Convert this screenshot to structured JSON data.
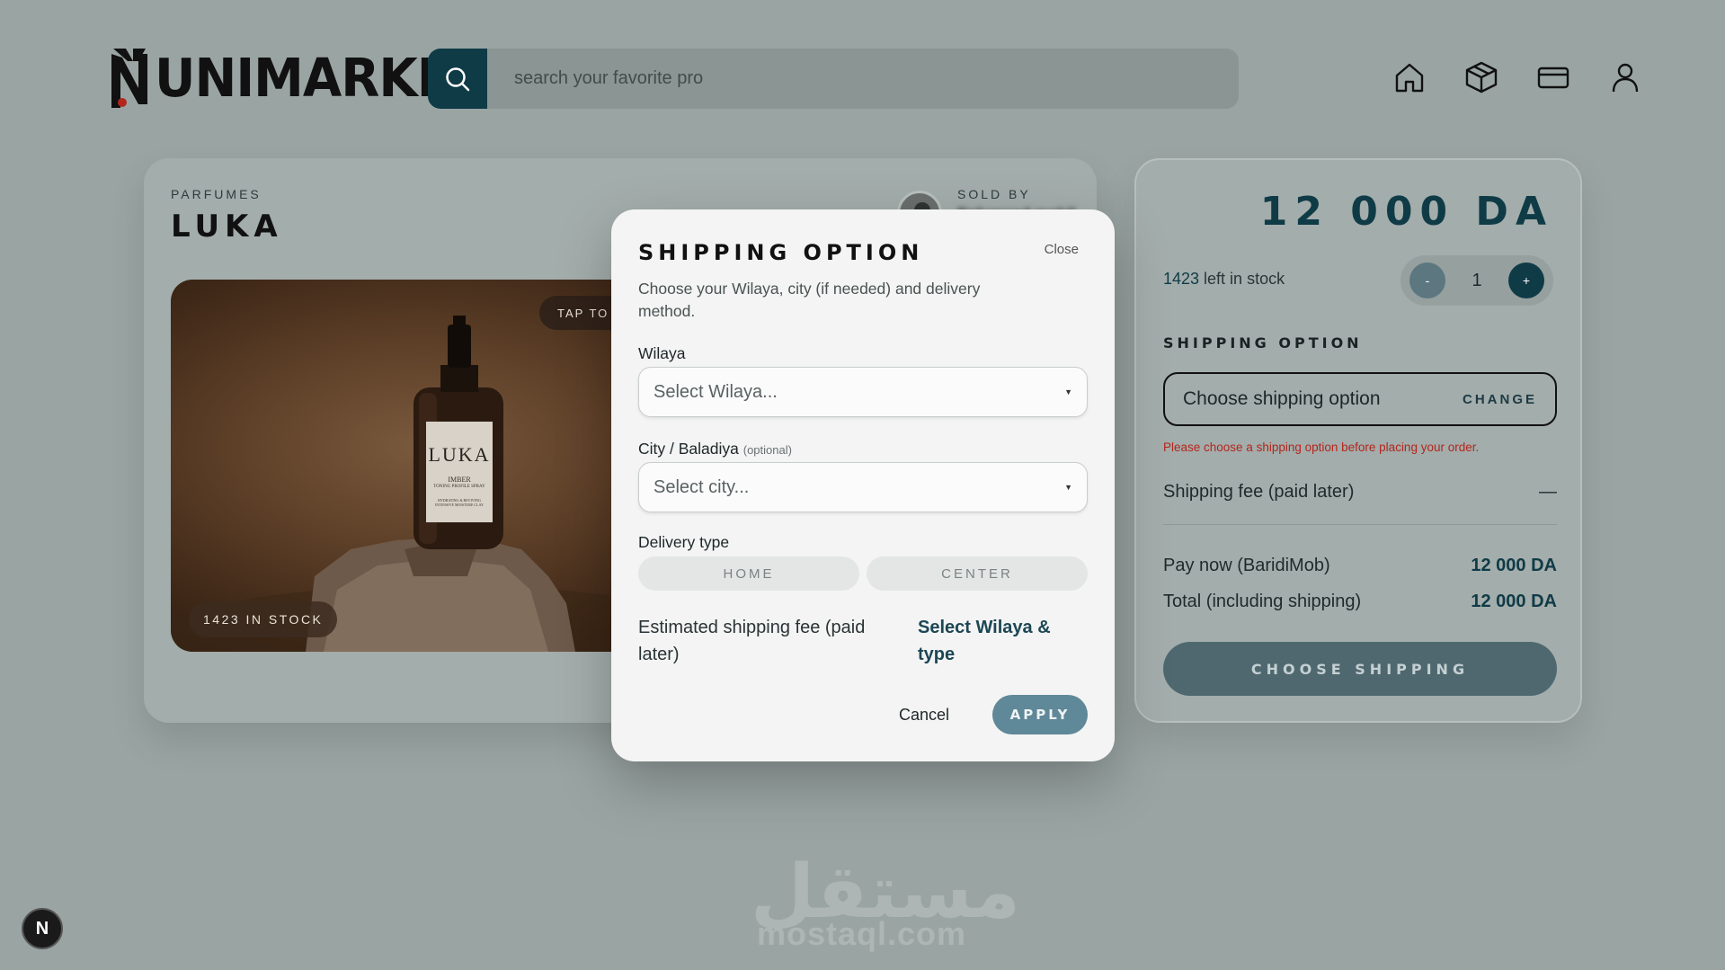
{
  "header": {
    "logo_text": "UNIMARKET",
    "search_placeholder": "search your favorite pro",
    "nav": [
      "home-icon",
      "box-icon",
      "card-icon",
      "user-icon"
    ]
  },
  "product": {
    "category": "PARFUMES",
    "title": "LUKA",
    "sold_by_label": "SOLD BY",
    "seller_name": "Enhanced mobil",
    "tap_to_zoom": "TAP TO ZOOM",
    "stock_badge": "1423 IN STOCK",
    "bottle_label": "LUKA",
    "bottle_sub": "IMBER",
    "bottle_sub2": "TONING PROFILE SPRAY",
    "bottle_sub3": "HYDRATING & REVIVING INTENSIVE MOISTURE CLAY"
  },
  "purchase": {
    "price": "12 000 DA",
    "stock_count": "1423",
    "stock_suffix": " left in stock",
    "qty_minus": "-",
    "qty_value": "1",
    "qty_plus": "+",
    "shipping_label": "SHIPPING OPTION",
    "shipping_select": "Choose shipping option",
    "shipping_change": "CHANGE",
    "shipping_error": "Please choose a shipping option before placing your order.",
    "fee_label": "Shipping fee (paid later)",
    "fee_value": "—",
    "pay_now_label": "Pay now (BaridiMob)",
    "pay_now_value": "12 000 DA",
    "total_label": "Total (including shipping)",
    "total_value": "12 000 DA",
    "choose_button": "CHOOSE SHIPPING"
  },
  "modal": {
    "title": "SHIPPING OPTION",
    "close": "Close",
    "description": "Choose your Wilaya, city (if needed) and delivery method.",
    "wilaya_label": "Wilaya",
    "wilaya_placeholder": "Select Wilaya...",
    "city_label": "City / Baladiya",
    "city_optional": "(optional)",
    "city_placeholder": "Select city...",
    "delivery_label": "Delivery type",
    "delivery_home": "HOME",
    "delivery_center": "CENTER",
    "est_label": "Estimated shipping fee (paid later)",
    "est_value": "Select Wilaya & type",
    "cancel": "Cancel",
    "apply": "APPLY"
  },
  "watermark": {
    "arabic": "مستقل",
    "latin": "mostaql.com"
  },
  "dev_badge": "N",
  "colors": {
    "accent": "#0f3b47",
    "background": "#9aa5a3",
    "error": "#b3261e",
    "apply_button": "#5f8898"
  }
}
